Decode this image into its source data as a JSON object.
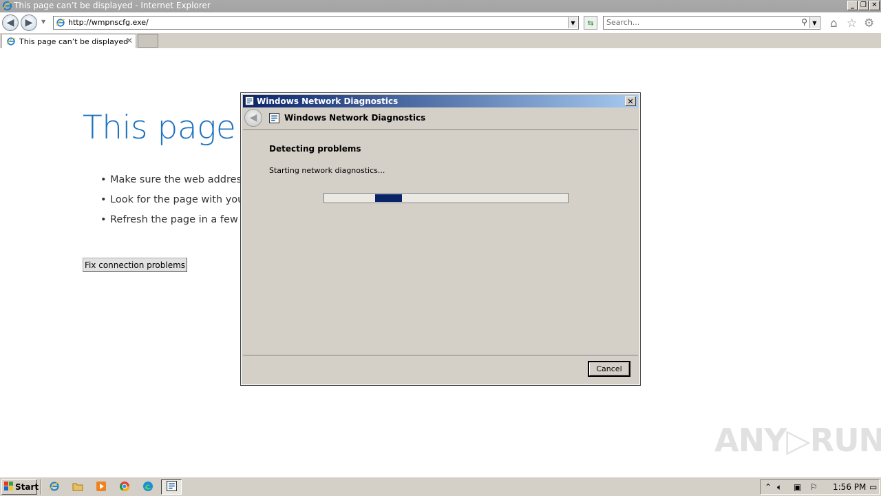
{
  "window": {
    "title": "This page can’t be displayed - Internet Explorer",
    "minimize_glyph": "_",
    "restore_glyph": "❐",
    "close_glyph": "✕"
  },
  "navbar": {
    "address": "http://wmpnscfg.exe/",
    "search_placeholder": "Search..."
  },
  "tabs": [
    {
      "label": "This page can’t be displayed",
      "active": true
    }
  ],
  "page": {
    "title": "This page c",
    "bullets": [
      "Make sure the web address h",
      "Look for the page with your",
      "Refresh the page in a few mi"
    ],
    "fix_button": "Fix connection problems"
  },
  "dialog": {
    "title": "Windows Network Diagnostics",
    "header": "Windows Network Diagnostics",
    "subtitle": "Detecting problems",
    "status": "Starting network diagnostics...",
    "cancel": "Cancel"
  },
  "taskbar": {
    "start": "Start",
    "clock": "1:56 PM"
  },
  "watermark": "ANY RUN",
  "colors": {
    "link_blue": "#1e73be",
    "dialog_title_start": "#0a246a",
    "dialog_title_end": "#a6caf0",
    "progress_chunk": "#0a246a"
  },
  "icons": {
    "ie_icon": "internet-explorer-icon",
    "back": "back-arrow-icon",
    "forward": "forward-arrow-icon",
    "home": "home-icon",
    "favorites": "star-icon",
    "tools": "gear-icon",
    "search": "magnifier-icon"
  }
}
